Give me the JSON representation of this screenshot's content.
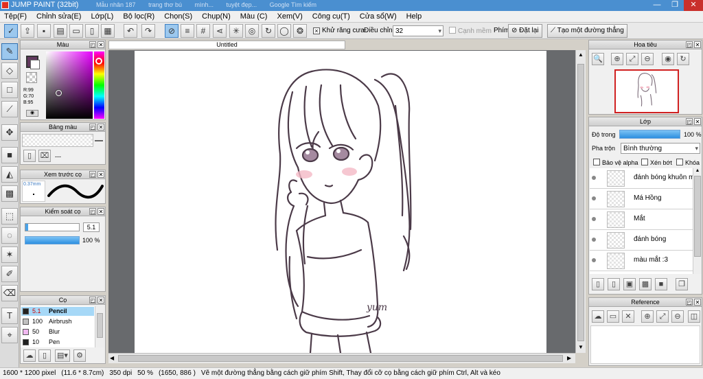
{
  "window": {
    "title": "JUMP PAINT (32bit)",
    "background_tabs": [
      "Mẫu nhân 187",
      "trang thơ bú",
      "mình...",
      "tuyệt đẹp...",
      "Google Tìm kiếm"
    ],
    "min_label": "—",
    "max_label": "❐",
    "close_label": "✕"
  },
  "menubar": {
    "items": [
      "Tệp(F)",
      "Chỉnh sửa(E)",
      "Lớp(L)",
      "Bộ lọc(R)",
      "Chọn(S)",
      "Chụp(N)",
      "Màu (C)",
      "Xem(V)",
      "Công cụ(T)",
      "Cửa sổ(W)",
      "Help"
    ]
  },
  "toolbar": {
    "antialias_label": "Khử răng cưa",
    "adjust_label": "Điều chỉnh",
    "adjust_value": "32",
    "smooth_label": "Cạnh mềm",
    "key_label": "Phím",
    "reset_label": "Đặt lại",
    "straight_line_label": "Tạo một đường thẳng"
  },
  "color_panel": {
    "title": "Màu",
    "r": "R:99",
    "g": "G:70",
    "b": "B:95",
    "fg_color": "#633a5f"
  },
  "palette_panel": {
    "title": "Bảng màu",
    "value": "---"
  },
  "brush_preview_panel": {
    "title": "Xem trước cọ",
    "size": "0.37mm"
  },
  "brush_control_panel": {
    "title": "Kiểm soát cọ",
    "size_value": "5.1",
    "opacity_value": "100 %",
    "opacity_level": 1.0
  },
  "brush_panel": {
    "title": "Cọ",
    "brushes": [
      {
        "size": "5.1",
        "name": "Pencil",
        "color": "#222222",
        "selected": true
      },
      {
        "size": "100",
        "name": "Airbrush",
        "color": "#c0c0c0",
        "selected": false
      },
      {
        "size": "50",
        "name": "Blur",
        "color": "#f0b8f0",
        "selected": false
      },
      {
        "size": "10",
        "name": "Pen",
        "color": "#222222",
        "selected": false
      }
    ]
  },
  "canvas": {
    "tab_title": "Untitled",
    "signature": "yum"
  },
  "navigator_panel": {
    "title": "Hoa tiêu"
  },
  "layer_panel": {
    "title": "Lớp",
    "opacity_label": "Độ trong",
    "opacity_value": "100 %",
    "opacity_level": 1.0,
    "blend_label": "Pha trộn",
    "blend_value": "Bình thường",
    "protect_alpha_label": "Bảo vệ alpha",
    "clip_label": "Xén bớt",
    "lock_label": "Khóa",
    "layers": [
      {
        "name": "đánh bóng khuôn m"
      },
      {
        "name": "Má Hồng"
      },
      {
        "name": "Mắt"
      },
      {
        "name": "đánh bóng"
      },
      {
        "name": "màu mắt :3"
      }
    ]
  },
  "reference_panel": {
    "title": "Reference"
  },
  "statusbar": {
    "size": "1600 * 1200 pixel",
    "physical": "(11.6 * 8.7cm)",
    "dpi": "350 dpi",
    "zoom": "50 %",
    "coords": "(1650, 886 )",
    "hint": "Vẽ một đường thẳng bằng cách giữ phím Shift, Thay đổi cỡ cọ bằng cách giữ phím Ctrl, Alt và kéo"
  }
}
